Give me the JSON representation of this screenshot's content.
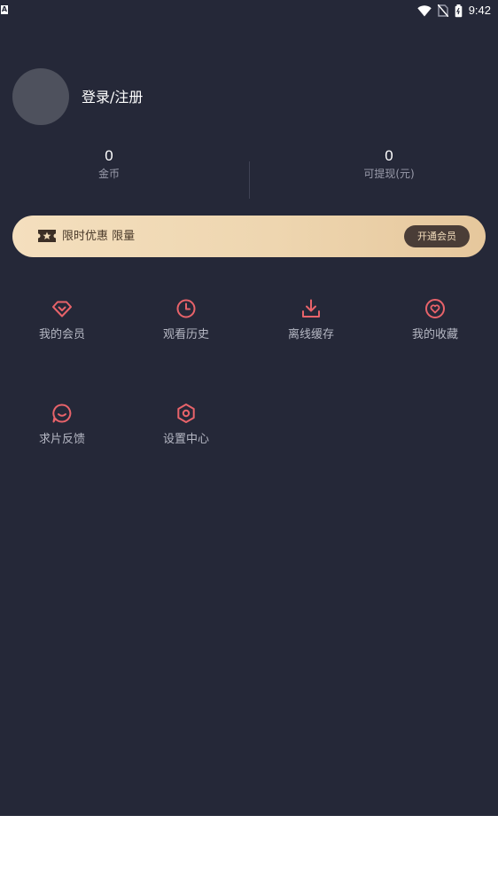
{
  "status_bar": {
    "time": "9:42",
    "left_badge": "A",
    "icons": [
      "wifi-icon",
      "no-sim-icon",
      "battery-icon"
    ]
  },
  "profile": {
    "login_label": "登录/注册"
  },
  "stats": [
    {
      "value": "0",
      "label": "金币"
    },
    {
      "value": "0",
      "label": "可提现(元)"
    }
  ],
  "promo": {
    "text": "限时优惠 限量",
    "button_label": "开通会员",
    "icon": "ticket-star-icon"
  },
  "menu": [
    {
      "label": "我的会员",
      "icon": "diamond-icon"
    },
    {
      "label": "观看历史",
      "icon": "clock-icon"
    },
    {
      "label": "离线缓存",
      "icon": "download-icon"
    },
    {
      "label": "我的收藏",
      "icon": "heart-icon"
    },
    {
      "label": "求片反馈",
      "icon": "chat-bubble-icon"
    },
    {
      "label": "设置中心",
      "icon": "settings-hexagon-icon"
    }
  ],
  "colors": {
    "background": "#252838",
    "accent_icon": "#e8636a",
    "promo_gradient_start": "#f4dfbe",
    "promo_gradient_end": "#e6c79c",
    "promo_button": "#4a3d37"
  }
}
